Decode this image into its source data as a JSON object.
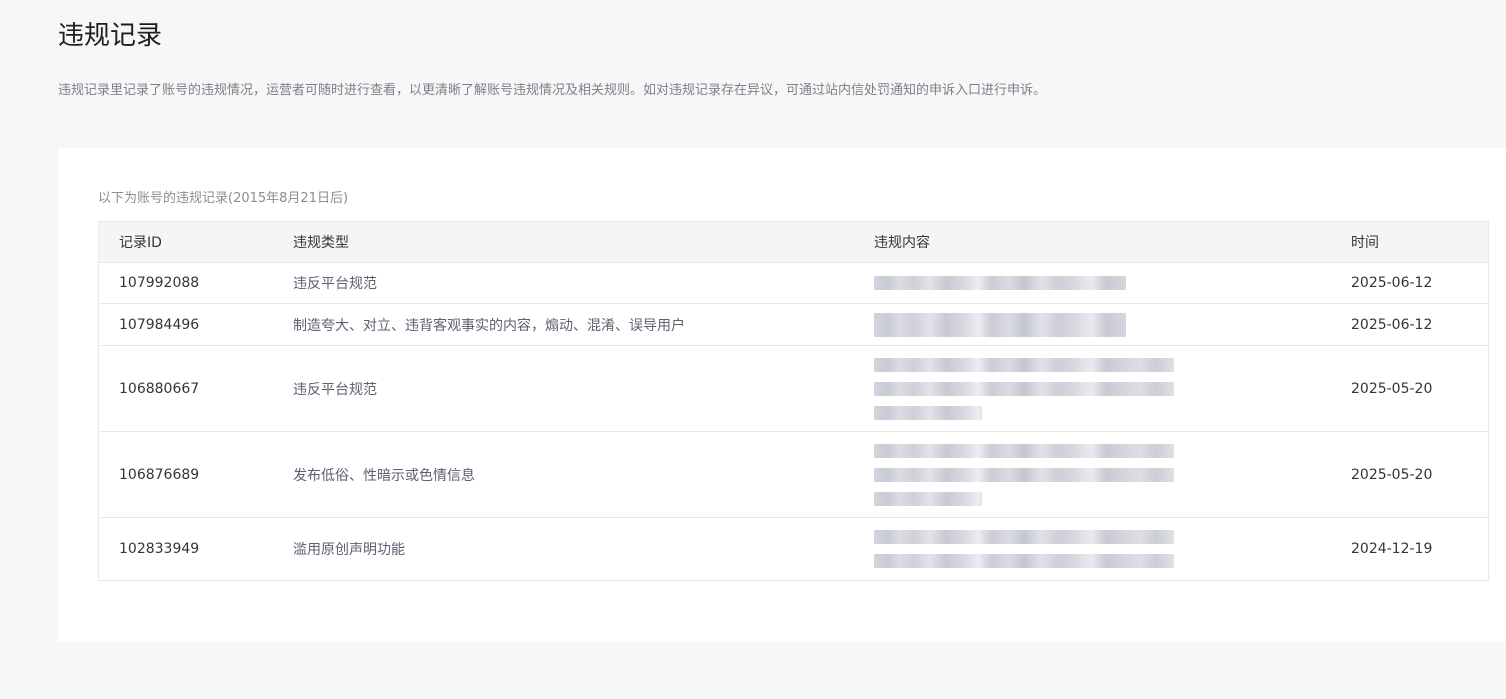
{
  "page": {
    "title": "违规记录",
    "description": "违规记录里记录了账号的违规情况，运营者可随时进行查看，以更清晰了解账号违规情况及相关规则。如对违规记录存在异议，可通过站内信处罚通知的申诉入口进行申诉。"
  },
  "card": {
    "caption": "以下为账号的违规记录(2015年8月21日后)"
  },
  "table": {
    "headers": {
      "id": "记录ID",
      "type": "违规类型",
      "content": "违规内容",
      "time": "时间"
    },
    "rows": [
      {
        "id": "107992088",
        "type": "违反平台规范",
        "time": "2025-06-12",
        "content_lines": 1
      },
      {
        "id": "107984496",
        "type": "制造夸大、对立、违背客观事实的内容，煽动、混淆、误导用户",
        "time": "2025-06-12",
        "content_lines": 1
      },
      {
        "id": "106880667",
        "type": "违反平台规范",
        "time": "2025-05-20",
        "content_lines": 3
      },
      {
        "id": "106876689",
        "type": "发布低俗、性暗示或色情信息",
        "time": "2025-05-20",
        "content_lines": 3
      },
      {
        "id": "102833949",
        "type": "滥用原创声明功能",
        "time": "2024-12-19",
        "content_lines": 2
      }
    ]
  }
}
